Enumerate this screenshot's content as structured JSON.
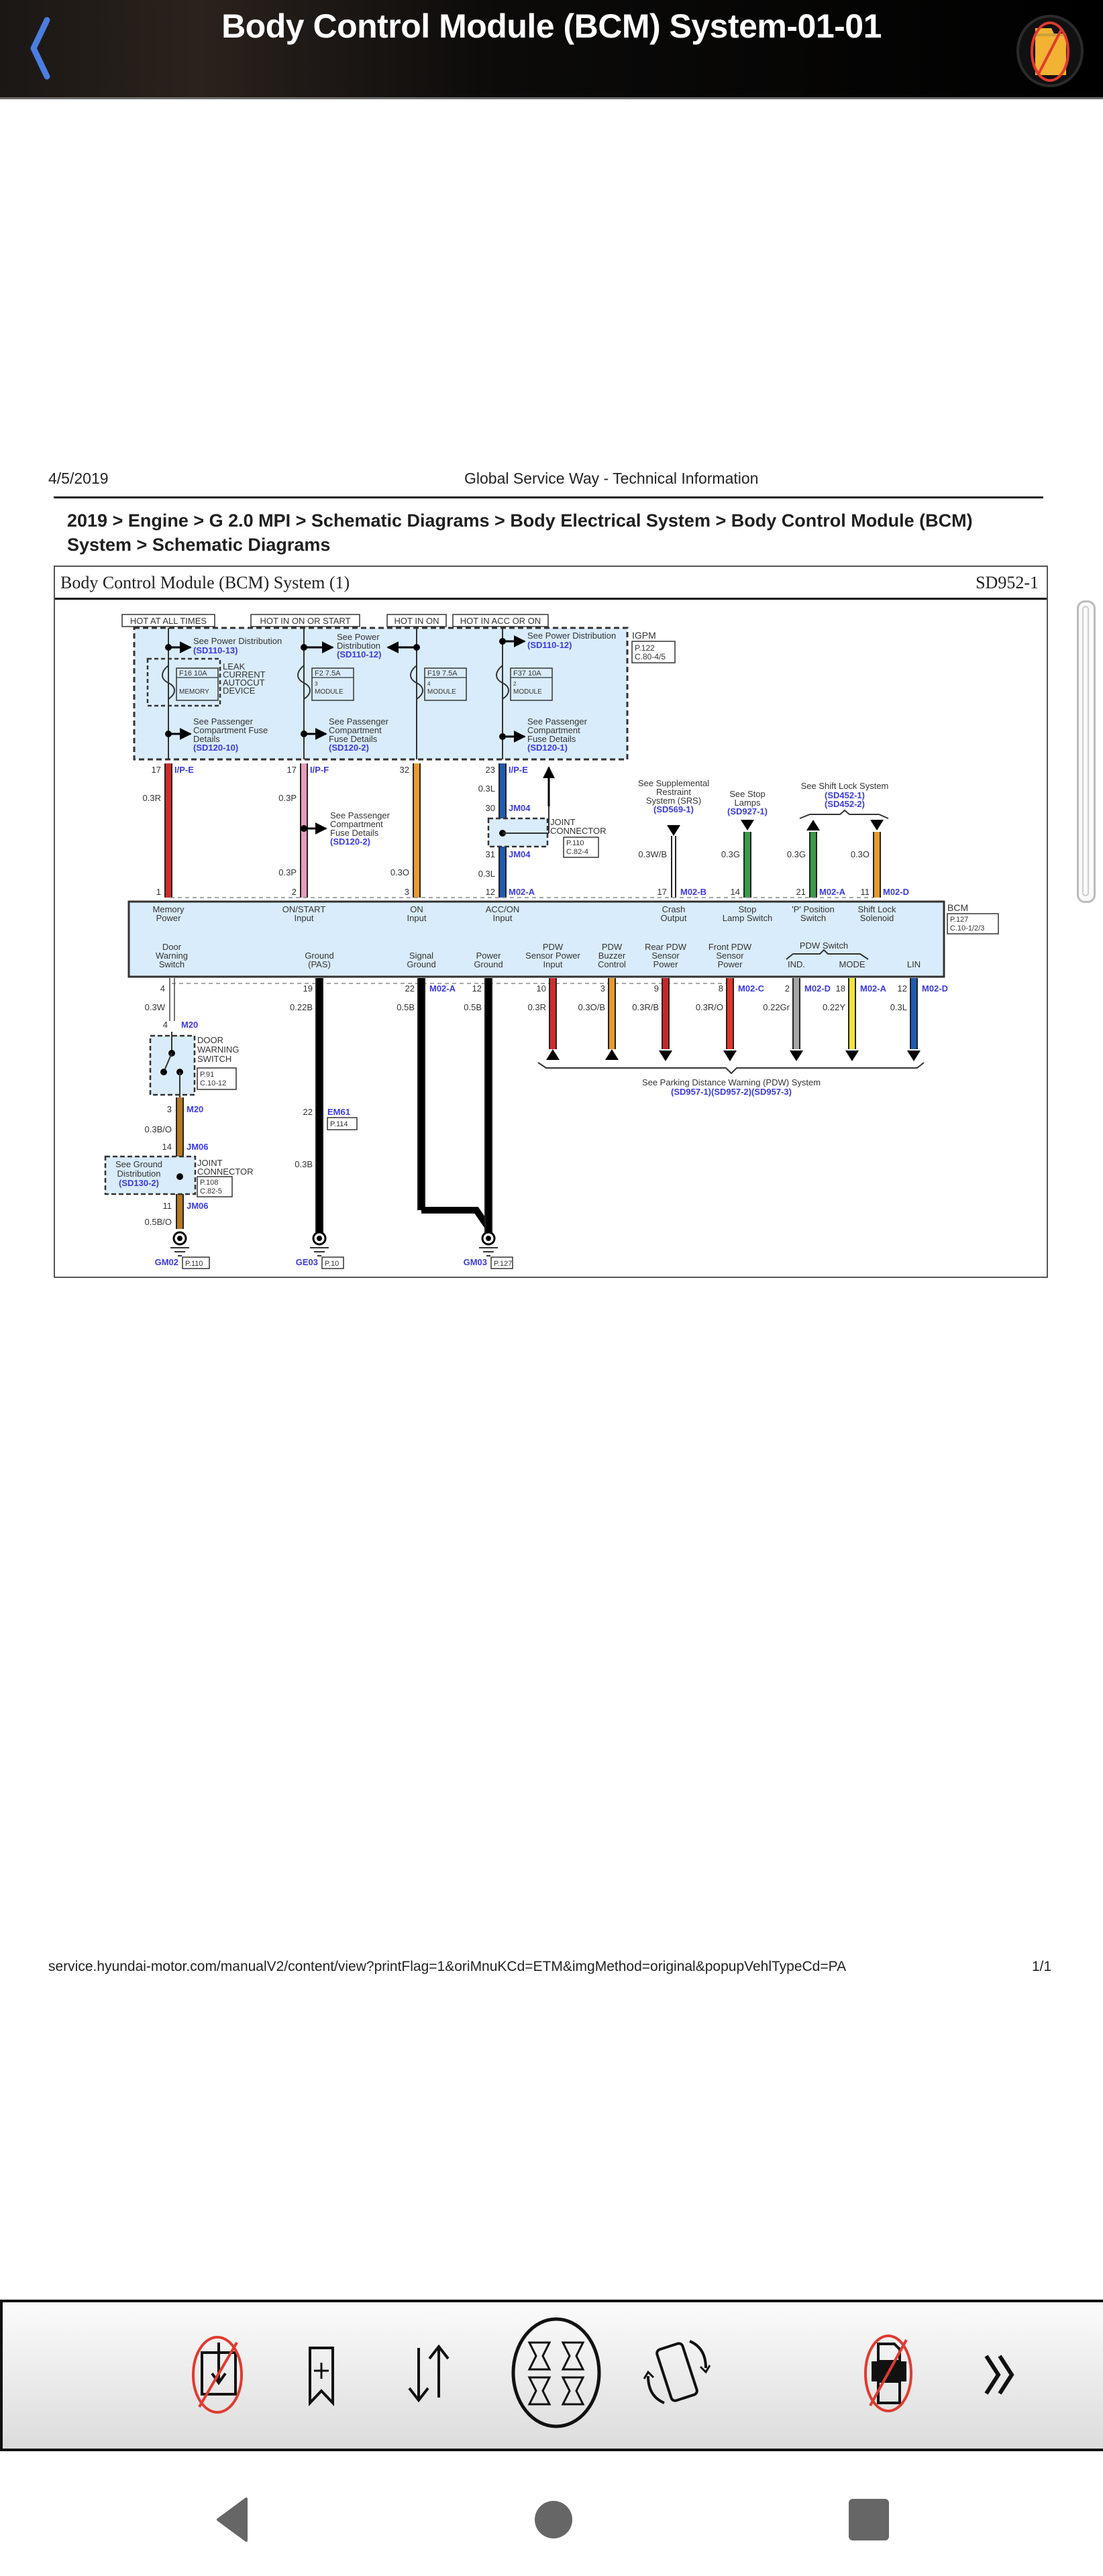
{
  "app": {
    "title": "Body Control Module (BCM) System-01-01",
    "back_icon": "chevron-left-icon",
    "folder_icon": "folder-disabled-icon"
  },
  "document": {
    "date": "4/5/2019",
    "site_title": "Global Service Way - Technical Information",
    "breadcrumb": "2019 > Engine > G 2.0 MPI > Schematic Diagrams > Body Electrical System > Body Control Module (BCM) System > Schematic Diagrams",
    "footer_url": "service.hyundai-motor.com/manualV2/content/view?printFlag=1&oriMnuKCd=ETM&imgMethod=original&popupVehlTypeCd=PA",
    "page_indicator": "1/1"
  },
  "diagram": {
    "title": "Body Control Module (BCM) System (1)",
    "code": "SD952-1",
    "power_labels": [
      "HOT AT ALL TIMES",
      "HOT IN ON OR START",
      "HOT IN ON",
      "HOT IN ACC OR ON"
    ],
    "igpm": {
      "name": "IGPM",
      "ref": [
        "P.122",
        "C.80-4/5"
      ]
    },
    "fuses": [
      {
        "id": "F16 10A",
        "label": "MEMORY",
        "num": ""
      },
      {
        "id": "F2 7.5A",
        "label": "MODULE",
        "num": "3"
      },
      {
        "id": "F19 7.5A",
        "label": "MODULE",
        "num": "4"
      },
      {
        "id": "F37 10A",
        "label": "MODULE",
        "num": "2"
      }
    ],
    "leak_device": [
      "LEAK",
      "CURRENT",
      "AUTOCUT",
      "DEVICE"
    ],
    "refs": {
      "pd_13": {
        "text": "See Power Distribution",
        "code": "(SD110-13)"
      },
      "pd_12a": {
        "text": [
          "See Power",
          "Distribution"
        ],
        "code": "(SD110-12)"
      },
      "pd_12b": {
        "text": "See Power Distribution",
        "code": "(SD110-12)"
      },
      "pcfd_10": {
        "text": [
          "See Passenger",
          "Compartment Fuse",
          "Details"
        ],
        "code": "(SD120-10)"
      },
      "pcfd_2a": {
        "text": [
          "See Passenger",
          "Compartment",
          "Fuse Details"
        ],
        "code": "(SD120-2)"
      },
      "pcfd_1": {
        "text": [
          "See Passenger",
          "Compartment",
          "Fuse Details"
        ],
        "code": "(SD120-1)"
      },
      "pcfd_2b": {
        "text": [
          "See Passenger",
          "Compartment",
          "Fuse Details"
        ],
        "code": "(SD120-2)"
      },
      "srs": {
        "text": [
          "See Supplemental",
          "Restraint",
          "System (SRS)"
        ],
        "code": "(SD569-1)"
      },
      "stop": {
        "text": [
          "See Stop",
          "Lamps"
        ],
        "code": "(SD927-1)"
      },
      "shift": {
        "text": [
          "See Shift Lock System"
        ],
        "code": [
          "(SD452-1)",
          "(SD452-2)"
        ]
      },
      "pdw": {
        "text": "See Parking Distance Warning (PDW) System",
        "code": "(SD957-1)(SD957-2)(SD957-3)"
      },
      "ground": {
        "text": [
          "See Ground",
          "Distribution"
        ],
        "code": "(SD130-2)"
      }
    },
    "joint_connector_1": {
      "name": [
        "JOINT",
        "CONNECTOR"
      ],
      "ref": [
        "P.110",
        "C.82-4"
      ]
    },
    "joint_connector_2": {
      "name": [
        "JOINT",
        "CONNECTOR"
      ],
      "ref": [
        "P.108",
        "C.82-5"
      ]
    },
    "door_switch": {
      "name": [
        "DOOR",
        "WARNING",
        "SWITCH"
      ],
      "ref": [
        "P.91",
        "C.10-12"
      ]
    },
    "bcm": {
      "name": "BCM",
      "ref": [
        "P.127",
        "C.10-1/2/3"
      ]
    },
    "top_wires": [
      {
        "pin_top": "17",
        "conn_top": "I/P-E",
        "gauge": "0.3R",
        "pin_bottom": "1",
        "conn_bottom": "",
        "color": "#d42a2a",
        "label": [
          "Memory",
          "Power"
        ]
      },
      {
        "pin_top": "17",
        "conn_top": "I/P-F",
        "gauge": "0.3P",
        "gauge2": "0.3P",
        "pin_bottom": "2",
        "conn_bottom": "",
        "color": "#e89bbd",
        "label": [
          "ON/START",
          "Input"
        ]
      },
      {
        "pin_top": "32",
        "conn_top": "",
        "gauge": "0.3O",
        "pin_bottom": "3",
        "conn_bottom": "",
        "color": "#e89a2d",
        "label": [
          "ON",
          "Input"
        ]
      },
      {
        "pin_top": "23",
        "conn_top": "I/P-E",
        "gauge": "0.3L",
        "pin_mid_a": "30",
        "conn_mid_a": "JM04",
        "pin_mid_b": "31",
        "conn_mid_b": "JM04",
        "gauge2": "0.3L",
        "pin_bottom": "12",
        "conn_bottom": "M02-A",
        "color": "#1f5bb0",
        "label": [
          "ACC/ON",
          "Input"
        ]
      },
      {
        "gauge": "0.3W/B",
        "pin_bottom": "17",
        "conn_bottom": "M02-B",
        "color": "#ffffff",
        "label": [
          "Crash",
          "Output"
        ]
      },
      {
        "gauge": "0.3G",
        "pin_bottom": "14",
        "conn_bottom": "",
        "color": "#3a9a4a",
        "label": [
          "Stop",
          "Lamp Switch"
        ]
      },
      {
        "gauge": "0.3G",
        "pin_bottom": "21",
        "conn_bottom": "M02-A",
        "color": "#3a9a4a",
        "label": [
          "'P' Position",
          "Switch"
        ]
      },
      {
        "gauge": "0.3O",
        "pin_bottom": "11",
        "conn_bottom": "M02-D",
        "color": "#e89a2d",
        "label": [
          "Shift Lock",
          "Solenoid"
        ]
      }
    ],
    "bottom_wires": [
      {
        "pin": "4",
        "conn": "",
        "gauge": "0.3W",
        "color": "#ffffff",
        "label": [
          "Door",
          "Warning",
          "Switch"
        ]
      },
      {
        "pin": "19",
        "conn": "",
        "gauge": "0.22B",
        "color": "#000000",
        "label": [
          "Ground",
          "(PAS)"
        ]
      },
      {
        "pin": "22",
        "conn": "M02-A",
        "gauge": "0.5B",
        "color": "#000000",
        "label": [
          "Signal",
          "Ground"
        ]
      },
      {
        "pin": "12",
        "conn": "",
        "gauge": "0.5B",
        "color": "#000000",
        "label": [
          "Power",
          "Ground"
        ]
      },
      {
        "pin": "10",
        "conn": "",
        "gauge": "0.3R",
        "color": "#d42a2a",
        "label": [
          "PDW",
          "Sensor Power",
          "Input"
        ]
      },
      {
        "pin": "3",
        "conn": "",
        "gauge": "0.3O/B",
        "color": "#e89a2d",
        "label": [
          "PDW",
          "Buzzer",
          "Control"
        ]
      },
      {
        "pin": "9",
        "conn": "",
        "gauge": "0.3R/B",
        "color": "#c9262a",
        "label": [
          "Rear PDW",
          "Sensor",
          "Power"
        ]
      },
      {
        "pin": "8",
        "conn": "M02-C",
        "gauge": "0.3R/O",
        "color": "#e0362a",
        "label": [
          "Front PDW",
          "Sensor",
          "Power"
        ]
      },
      {
        "pin": "2",
        "conn": "M02-D",
        "gauge": "0.22Gr",
        "color": "#a5a5a5",
        "label": [
          "IND."
        ]
      },
      {
        "pin": "18",
        "conn": "M02-A",
        "gauge": "0.22Y",
        "color": "#f2e33a",
        "label": [
          "MODE"
        ]
      },
      {
        "pin": "12",
        "conn": "M02-D",
        "gauge": "0.3L",
        "color": "#1f5bb0",
        "label": [
          "LIN"
        ]
      }
    ],
    "pdw_switch_label": "PDW Switch",
    "door_chain": [
      {
        "pin": "4",
        "conn": "M20"
      },
      {
        "pin": "3",
        "conn": "M20",
        "gauge": "0.3B/O"
      },
      {
        "pin": "14",
        "conn": "JM06"
      },
      {
        "pin": "11",
        "conn": "JM06",
        "gauge": "0.5B/O"
      }
    ],
    "ground_pas": {
      "pin": "22",
      "conn": "EM61",
      "ref": "P.114",
      "gauge": "0.3B"
    },
    "grounds": [
      {
        "name": "GM02",
        "ref": "P.110"
      },
      {
        "name": "GE03",
        "ref": "P.10"
      },
      {
        "name": "GM03",
        "ref": "P.127"
      }
    ]
  },
  "toolbar": {
    "buttons": [
      {
        "name": "download-disabled-button",
        "icon": "download-disabled-icon"
      },
      {
        "name": "bookmark-add-button",
        "icon": "bookmark-plus-icon"
      },
      {
        "name": "sort-button",
        "icon": "sort-arrows-icon"
      },
      {
        "name": "fit-screen-button",
        "icon": "expand-arrows-icon"
      },
      {
        "name": "rotate-button",
        "icon": "rotate-device-icon"
      },
      {
        "name": "print-disabled-button",
        "icon": "print-disabled-icon"
      },
      {
        "name": "more-button",
        "icon": "double-chevron-right-icon"
      }
    ]
  },
  "navbar": {
    "back": "nav-back-icon",
    "home": "nav-home-icon",
    "recents": "nav-recents-icon"
  }
}
